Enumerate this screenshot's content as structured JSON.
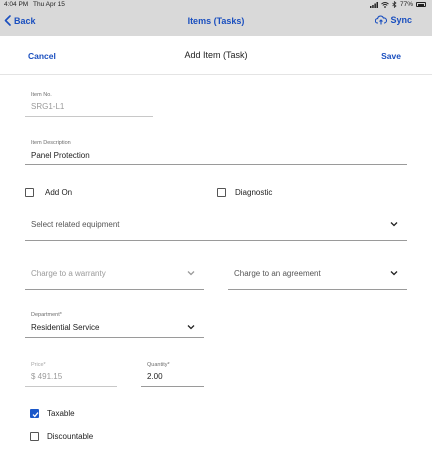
{
  "status_bar": {
    "time": "4:04 PM",
    "date": "Thu Apr 15",
    "battery": "77%"
  },
  "nav": {
    "back_label": "Back",
    "title": "Items (Tasks)",
    "sync_label": "Sync"
  },
  "modal": {
    "cancel_label": "Cancel",
    "title": "Add Item (Task)",
    "save_label": "Save"
  },
  "form": {
    "item_no": {
      "label": "Item No.",
      "value": "SRG1-L1"
    },
    "item_description": {
      "label": "Item Description",
      "value": "Panel Protection"
    },
    "add_on": {
      "label": "Add On",
      "checked": false
    },
    "diagnostic": {
      "label": "Diagnostic",
      "checked": false
    },
    "related_equipment": {
      "placeholder": "Select related equipment"
    },
    "warranty": {
      "placeholder": "Charge to a warranty"
    },
    "agreement": {
      "placeholder": "Charge to an agreement"
    },
    "department": {
      "label": "Department*",
      "value": "Residential Service"
    },
    "price": {
      "label": "Price*",
      "value": "$ 491.15"
    },
    "quantity": {
      "label": "Quantity*",
      "value": "2.00"
    },
    "taxable": {
      "label": "Taxable",
      "checked": true
    },
    "discountable": {
      "label": "Discountable",
      "checked": false
    }
  },
  "colors": {
    "accent": "#1a4fbf",
    "nav_bg": "#d9d9d9",
    "checkbox_checked": "#1a57c9"
  }
}
